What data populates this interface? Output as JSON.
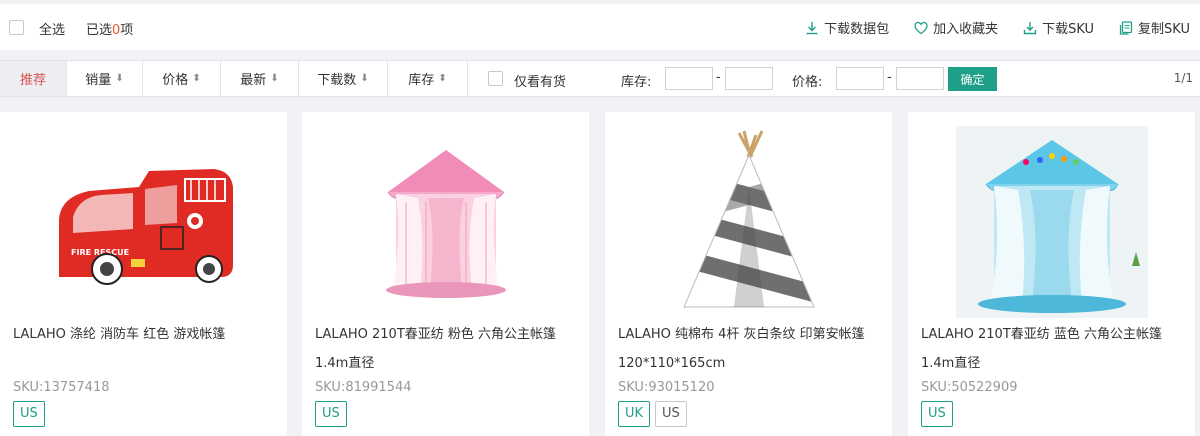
{
  "topbar": {
    "select_all": "全选",
    "selected_prefix": "已选",
    "selected_count": "0",
    "selected_suffix": "项",
    "actions": [
      {
        "label": "下载数据包",
        "icon": "download-icon"
      },
      {
        "label": "加入收藏夹",
        "icon": "heart-icon"
      },
      {
        "label": "下载SKU",
        "icon": "download-tray-icon"
      },
      {
        "label": "复制SKU",
        "icon": "copy-icon"
      }
    ]
  },
  "filters": {
    "sorts": [
      {
        "label": "推荐",
        "arrow": ""
      },
      {
        "label": "销量",
        "arrow": "⬇"
      },
      {
        "label": "价格",
        "arrow": "⬍"
      },
      {
        "label": "最新",
        "arrow": "⬇"
      },
      {
        "label": "下载数",
        "arrow": "⬇"
      },
      {
        "label": "库存",
        "arrow": "⬍"
      }
    ],
    "instock_label": "仅看有货",
    "stock_label": "库存:",
    "price_label": "价格:",
    "dash": "-",
    "confirm_label": "确定",
    "pager": "1/1"
  },
  "products": [
    {
      "title": "LALAHO 涤纶 消防车 红色 游戏帐篷",
      "sku": "SKU:13757418",
      "tags": [
        "US"
      ],
      "image": "red-fire-truck-tent"
    },
    {
      "title": "LALAHO 210T春亚纺 粉色 六角公主帐篷 1.4m直径",
      "sku": "SKU:81991544",
      "tags": [
        "US"
      ],
      "image": "pink-hexagon-princess-tent"
    },
    {
      "title": "LALAHO 纯棉布 4杆 灰白条纹 印第安帐篷120*110*165cm",
      "sku": "SKU:93015120",
      "tags": [
        "UK",
        "US"
      ],
      "image": "gray-striped-teepee-tent"
    },
    {
      "title": "LALAHO 210T春亚纺 蓝色 六角公主帐篷 1.4m直径",
      "sku": "SKU:50522909",
      "tags": [
        "US"
      ],
      "image": "blue-hexagon-princess-tent"
    }
  ],
  "colors": {
    "accent": "#1e9f88",
    "active_sort": "#d9534f",
    "count": "#e8562a"
  }
}
